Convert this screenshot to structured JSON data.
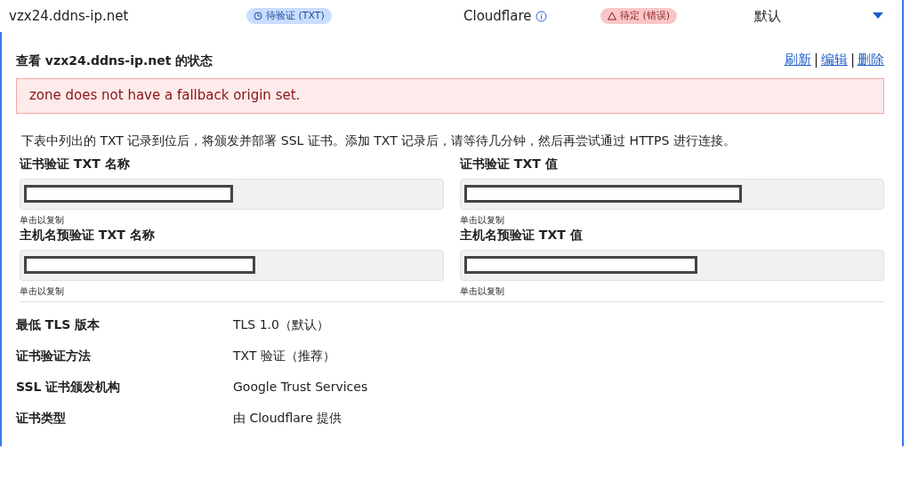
{
  "row": {
    "hostname": "vzx24.ddns-ip.net",
    "validation_badge": "待验证 (TXT)",
    "provider": "Cloudflare",
    "status_badge": "待定 (错误)",
    "setting": "默认",
    "expanded": true
  },
  "panel": {
    "title": "查看 vzx24.ddns-ip.net 的状态",
    "actions": [
      "刷新",
      "编辑",
      "删除"
    ],
    "action_separator": "|",
    "error": "zone does not have a fallback origin set.",
    "description": "下表中列出的 TXT 记录到位后，将颁发并部署 SSL 证书。添加 TXT 记录后，请等待几分钟，然后再尝试通过 HTTPS 进行连接。",
    "fields": [
      {
        "label": "证书验证 TXT 名称",
        "hint": "单击以复制"
      },
      {
        "label": "证书验证 TXT 值",
        "hint": "单击以复制"
      },
      {
        "label": "主机名预验证 TXT 名称",
        "hint": "单击以复制"
      },
      {
        "label": "主机名预验证 TXT 值",
        "hint": "单击以复制"
      }
    ],
    "details": [
      {
        "label": "最低 TLS 版本",
        "value": "TLS 1.0（默认）"
      },
      {
        "label": "证书验证方法",
        "value": "TXT 验证（推荐）"
      },
      {
        "label": "SSL 证书颁发机构",
        "value": "Google Trust Services"
      },
      {
        "label": "证书类型",
        "value": "由 Cloudflare 提供"
      }
    ]
  }
}
